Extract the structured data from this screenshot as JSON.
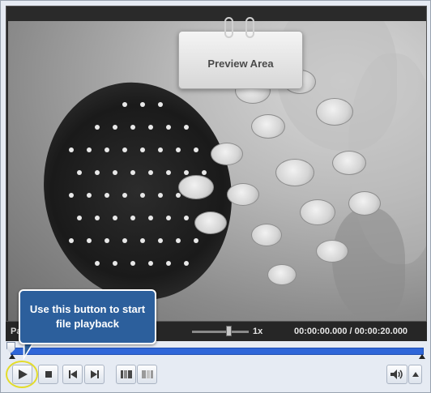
{
  "preview": {
    "tag_label": "Preview Area"
  },
  "status": {
    "label": "Pa",
    "speed": "1x",
    "timecode": "00:00:00.000 / 00:00:20.000"
  },
  "callout": {
    "text": "Use this button to start file playback"
  },
  "timeline": {
    "position_fraction": 0
  },
  "icons": {
    "play": "play-icon",
    "stop": "stop-icon",
    "previous": "skip-back-icon",
    "next": "skip-forward-icon",
    "mark_in": "mark-in-icon",
    "mark_out": "mark-out-icon",
    "volume": "speaker-icon",
    "volume_menu": "chevron-up-icon"
  },
  "colors": {
    "timeline": "#2f66d8",
    "callout": "#2c5f9c",
    "highlight_ring": "#e3dc2a"
  }
}
